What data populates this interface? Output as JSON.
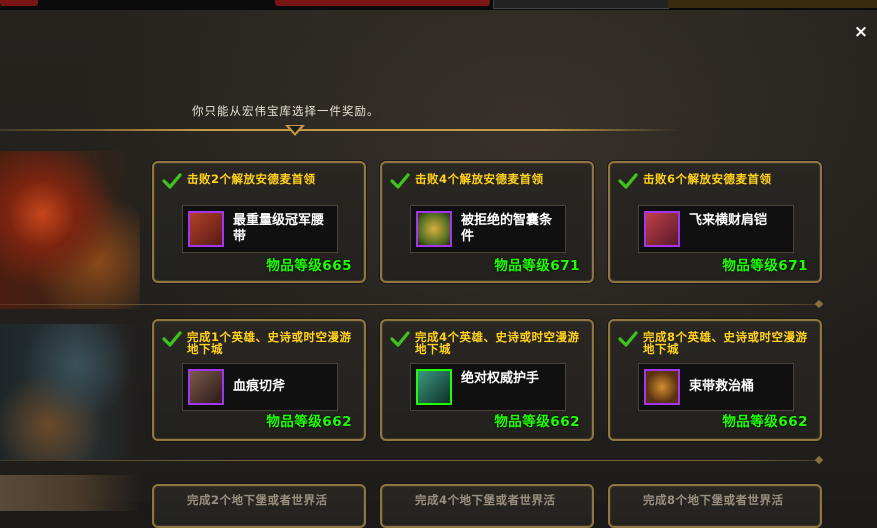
{
  "header": {
    "instruction": "你只能从宏伟宝库选择一件奖励。"
  },
  "close_symbol": "×",
  "rows": [
    {
      "cards": [
        {
          "title": "击败2个解放安德麦首领",
          "item_name": "最重量级冠军腰带",
          "item_level": "物品等级665",
          "icon_color": "#8a2a20"
        },
        {
          "title": "击败4个解放安德麦首领",
          "item_name": "被拒绝的智囊条件",
          "item_level": "物品等级671",
          "icon_color": "#7a6a20"
        },
        {
          "title": "击败6个解放安德麦首领",
          "item_name": "飞来横财肩铠",
          "item_level": "物品等级671",
          "icon_color": "#7a2a2a"
        }
      ]
    },
    {
      "cards": [
        {
          "title": "完成1个英雄、史诗或时空漫游地下城",
          "item_name": "血痕切斧",
          "item_level": "物品等级662",
          "icon_color": "#5a3a30"
        },
        {
          "title": "完成4个英雄、史诗或时空漫游地下城",
          "item_name": "绝对权威护手",
          "item_level": "物品等级662",
          "icon_color": "#2a6a5a"
        },
        {
          "title": "完成8个英雄、史诗或时空漫游地下城",
          "item_name": "束带救治桶",
          "item_level": "物品等级662",
          "icon_color": "#6a4a20"
        }
      ]
    },
    {
      "cards": [
        {
          "title": "完成2个地下堡或者世界活"
        },
        {
          "title": "完成4个地下堡或者世界活"
        },
        {
          "title": "完成8个地下堡或者世界活"
        }
      ]
    }
  ],
  "colors": {
    "frame": "#8f7540",
    "title_yellow": "#ffd21a",
    "item_level_green": "#1eff00",
    "epic_purple": "#a335ee",
    "check_green": "#3ec41e"
  }
}
